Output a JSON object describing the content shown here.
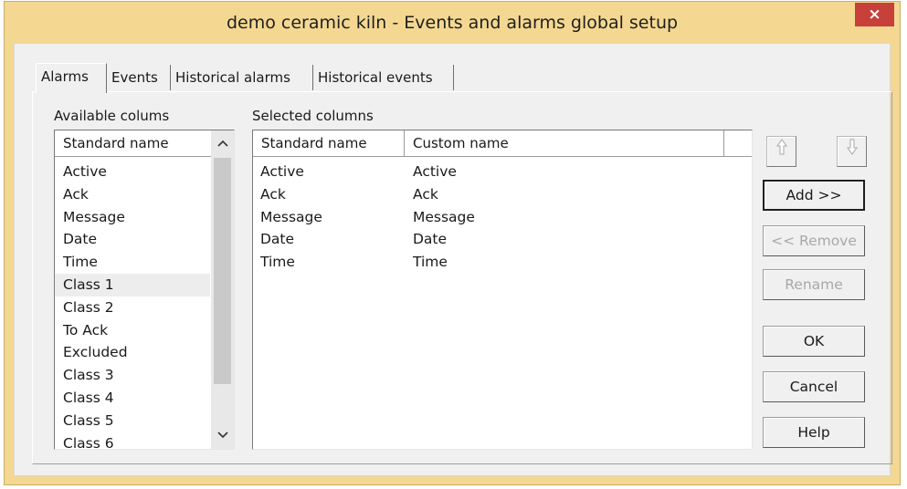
{
  "window": {
    "title": "demo ceramic kiln - Events and alarms global setup",
    "close_glyph": "×"
  },
  "tabs": [
    {
      "label": "Alarms"
    },
    {
      "label": "Events"
    },
    {
      "label": "Historical alarms"
    },
    {
      "label": "Historical events"
    }
  ],
  "available": {
    "label": "Available colums",
    "header": "Standard name",
    "items": [
      "Active",
      "Ack",
      "Message",
      "Date",
      "Time",
      "Class 1",
      "Class 2",
      "To Ack",
      "Excluded",
      "Class 3",
      "Class 4",
      "Class 5",
      "Class 6"
    ],
    "highlighted": "Class 1"
  },
  "selected": {
    "label": "Selected columns",
    "headers": [
      "Standard name",
      "Custom name"
    ],
    "rows": [
      [
        "Active",
        "Active"
      ],
      [
        "Ack",
        "Ack"
      ],
      [
        "Message",
        "Message"
      ],
      [
        "Date",
        "Date"
      ],
      [
        "Time",
        "Time"
      ]
    ]
  },
  "icons": {
    "move_up": "up-arrow-icon",
    "move_down": "down-arrow-icon",
    "scroll_up": "chevron-up-icon",
    "scroll_down": "chevron-down-icon"
  },
  "buttons": {
    "add": "Add >>",
    "remove": "<< Remove",
    "rename": "Rename",
    "ok": "OK",
    "cancel": "Cancel",
    "help": "Help"
  },
  "colors": {
    "window_frame": "#f4d892",
    "close_button": "#c7403a",
    "dialog_background": "#f0f0f0"
  }
}
